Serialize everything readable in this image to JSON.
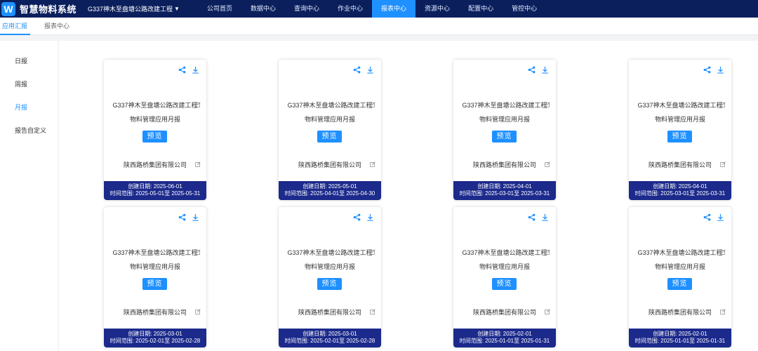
{
  "app": {
    "logo_letter": "W",
    "title": "智慧物料系统",
    "project": "G337神木至盘塘公路改建工程"
  },
  "nav": [
    "公司首页",
    "数据中心",
    "查询中心",
    "作业中心",
    "报表中心",
    "资源中心",
    "配置中心",
    "管控中心"
  ],
  "active_nav": "报表中心",
  "subtabs": [
    "应用汇报",
    "报表中心"
  ],
  "sidebar": [
    "日报",
    "周报",
    "月报",
    "报告自定义"
  ],
  "cards": [
    {
      "title": "G337神木至盘塘公路改建工程",
      "subtitle": "物料管理应用月报",
      "preview": "预览",
      "company": "陕西路桥集团有限公司",
      "created": "创建日期: 2025-06-01",
      "range": "时间范围: 2025-05-01至 2025-05-31"
    },
    {
      "title": "G337神木至盘塘公路改建工程",
      "subtitle": "物料管理应用月报",
      "preview": "预览",
      "company": "陕西路桥集团有限公司",
      "created": "创建日期: 2025-05-01",
      "range": "时间范围: 2025-04-01至 2025-04-30"
    },
    {
      "title": "G337神木至盘塘公路改建工程",
      "subtitle": "物料管理应用月报",
      "preview": "预览",
      "company": "陕西路桥集团有限公司",
      "created": "创建日期: 2025-04-01",
      "range": "时间范围: 2025-03-01至 2025-03-31"
    },
    {
      "title": "G337神木至盘塘公路改建工程",
      "subtitle": "物料管理应用月报",
      "preview": "预览",
      "company": "陕西路桥集团有限公司",
      "created": "创建日期: 2025-04-01",
      "range": "时间范围: 2025-03-01至 2025-03-31"
    },
    {
      "title": "G337神木至盘塘公路改建工程",
      "subtitle": "物料管理应用月报",
      "preview": "预览",
      "company": "陕西路桥集团有限公司",
      "created": "创建日期: 2025-03-01",
      "range": "时间范围: 2025-02-01至 2025-02-28"
    },
    {
      "title": "G337神木至盘塘公路改建工程",
      "subtitle": "物料管理应用月报",
      "preview": "预览",
      "company": "陕西路桥集团有限公司",
      "created": "创建日期: 2025-03-01",
      "range": "时间范围: 2025-02-01至 2025-02-28"
    },
    {
      "title": "G337神木至盘塘公路改建工程",
      "subtitle": "物料管理应用月报",
      "preview": "预览",
      "company": "陕西路桥集团有限公司",
      "created": "创建日期: 2025-02-01",
      "range": "时间范围: 2025-01-01至 2025-01-31"
    },
    {
      "title": "G337神木至盘塘公路改建工程",
      "subtitle": "物料管理应用月报",
      "preview": "预览",
      "company": "陕西路桥集团有限公司",
      "created": "创建日期: 2025-02-01",
      "range": "时间范围: 2025-01-01至 2025-01-31"
    }
  ],
  "colors": {
    "topbar": "#0a1f5c",
    "accent": "#1e90ff",
    "card_footer": "#1c2a8c"
  },
  "icons": {
    "share": "share-icon",
    "download": "download-icon",
    "edit": "edit-icon",
    "caret": "caret-down-icon"
  }
}
